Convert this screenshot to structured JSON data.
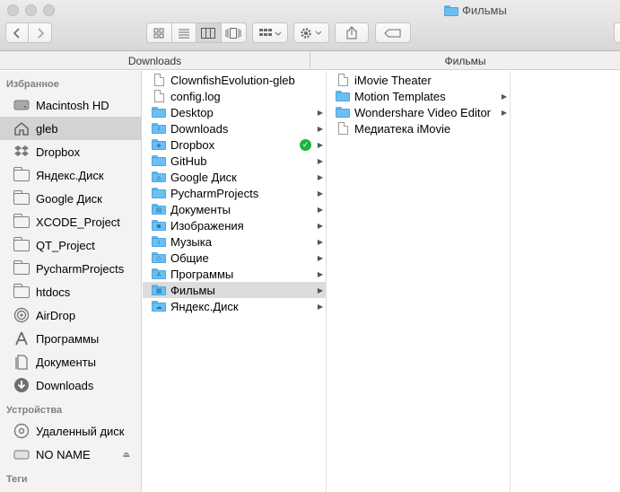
{
  "window": {
    "title": "Фильмы"
  },
  "toolbar": {
    "back_icon": "chevron-left-icon",
    "forward_icon": "chevron-right-icon",
    "view_icons": [
      "icon-view-icon",
      "list-view-icon",
      "column-view-icon",
      "cover-flow-icon"
    ],
    "arrange_icon": "arrange-grid-icon",
    "action_icon": "gear-icon",
    "share_icon": "share-icon",
    "tags_icon": "tag-icon"
  },
  "pathbar": {
    "left": "Downloads",
    "right": "Фильмы"
  },
  "sidebar": {
    "favorites_header": "Избранное",
    "favorites": [
      {
        "label": "Macintosh HD",
        "icon": "hard-drive-icon"
      },
      {
        "label": "gleb",
        "icon": "home-icon",
        "selected": true
      },
      {
        "label": "Dropbox",
        "icon": "dropbox-icon"
      },
      {
        "label": "Яндекс.Диск",
        "icon": "folder-icon"
      },
      {
        "label": "Google Диск",
        "icon": "folder-icon"
      },
      {
        "label": "XCODE_Project",
        "icon": "folder-icon"
      },
      {
        "label": "QT_Project",
        "icon": "folder-icon"
      },
      {
        "label": "PycharmProjects",
        "icon": "folder-icon"
      },
      {
        "label": "htdocs",
        "icon": "folder-icon"
      },
      {
        "label": "AirDrop",
        "icon": "airdrop-icon"
      },
      {
        "label": "Программы",
        "icon": "applications-icon"
      },
      {
        "label": "Документы",
        "icon": "documents-icon"
      },
      {
        "label": "Downloads",
        "icon": "downloads-icon"
      }
    ],
    "devices_header": "Устройства",
    "devices": [
      {
        "label": "Удаленный диск",
        "icon": "remote-disc-icon"
      },
      {
        "label": "NO NAME",
        "icon": "external-drive-icon",
        "ejectable": true
      }
    ],
    "tags_header": "Теги"
  },
  "column1": {
    "items": [
      {
        "label": "ClownfishEvolution-gleb",
        "kind": "doc"
      },
      {
        "label": "config.log",
        "kind": "doc"
      },
      {
        "label": "Desktop",
        "kind": "folder",
        "arrow": true,
        "badge": ""
      },
      {
        "label": "Downloads",
        "kind": "folder",
        "arrow": true,
        "badge": "⭳"
      },
      {
        "label": "Dropbox",
        "kind": "folder",
        "arrow": true,
        "badge": "◈",
        "synced": true
      },
      {
        "label": "GitHub",
        "kind": "folder",
        "arrow": true,
        "badge": ""
      },
      {
        "label": "Google Диск",
        "kind": "folder",
        "arrow": true,
        "badge": "◬"
      },
      {
        "label": "PycharmProjects",
        "kind": "folder",
        "arrow": true,
        "badge": ""
      },
      {
        "label": "Документы",
        "kind": "folder",
        "arrow": true,
        "badge": "▤"
      },
      {
        "label": "Изображения",
        "kind": "folder",
        "arrow": true,
        "badge": "◙"
      },
      {
        "label": "Музыка",
        "kind": "folder",
        "arrow": true,
        "badge": "♪"
      },
      {
        "label": "Общие",
        "kind": "folder",
        "arrow": true,
        "badge": "◇"
      },
      {
        "label": "Программы",
        "kind": "folder",
        "arrow": true,
        "badge": "A"
      },
      {
        "label": "Фильмы",
        "kind": "folder",
        "arrow": true,
        "badge": "▦",
        "selected": true
      },
      {
        "label": "Яндекс.Диск",
        "kind": "folder",
        "arrow": true,
        "badge": "☁"
      }
    ]
  },
  "column2": {
    "items": [
      {
        "label": "iMovie Theater",
        "kind": "doc"
      },
      {
        "label": "Motion Templates",
        "kind": "folder",
        "arrow": true
      },
      {
        "label": "Wondershare Video Editor",
        "kind": "folder",
        "arrow": true
      },
      {
        "label": "Медиатека iMovie",
        "kind": "doc"
      }
    ]
  },
  "colors": {
    "folder_blue": "#6cc0f1",
    "selection_gray": "#dcdcdc",
    "sync_green": "#1fb141"
  }
}
